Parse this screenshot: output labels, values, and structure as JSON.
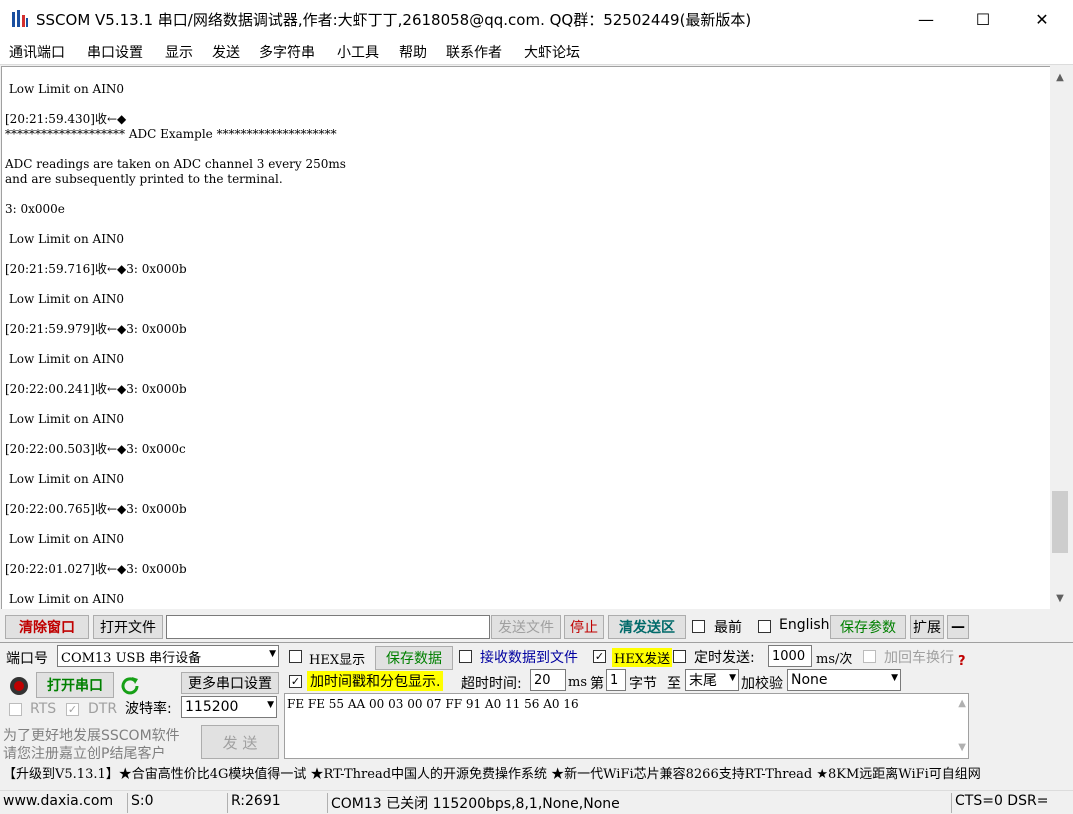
{
  "window": {
    "title": "SSCOM V5.13.1 串口/网络数据调试器,作者:大虾丁丁,2618058@qq.com. QQ群：52502449(最新版本)",
    "minimize": "—",
    "maximize": "☐",
    "close": "✕"
  },
  "menu": [
    "通讯端口",
    "串口设置",
    "显示",
    "发送",
    "多字符串",
    "小工具",
    "帮助",
    "联系作者",
    "大虾论坛"
  ],
  "terminal": {
    "lines": [
      " Low Limit on AIN0",
      "",
      "[20:21:59.430]收←◆",
      "******************** ADC Example ********************",
      "",
      "ADC readings are taken on ADC channel 3 every 250ms",
      "and are subsequently printed to the terminal.",
      "",
      "3: 0x000e",
      "",
      " Low Limit on AIN0",
      "",
      "[20:21:59.716]收←◆3: 0x000b",
      "",
      " Low Limit on AIN0",
      "",
      "[20:21:59.979]收←◆3: 0x000b",
      "",
      " Low Limit on AIN0",
      "",
      "[20:22:00.241]收←◆3: 0x000b",
      "",
      " Low Limit on AIN0",
      "",
      "[20:22:00.503]收←◆3: 0x000c",
      "",
      " Low Limit on AIN0",
      "",
      "[20:22:00.765]收←◆3: 0x000b",
      "",
      " Low Limit on AIN0",
      "",
      "[20:22:01.027]收←◆3: 0x000b",
      "",
      " Low Limit on AIN0"
    ]
  },
  "toolbar": {
    "clear_window": "清除窗口",
    "open_file": "打开文件",
    "file_path": "",
    "send_file": "发送文件",
    "stop": "停止",
    "clear_send": "清发送区",
    "topmost": "最前",
    "english": "English",
    "save_params": "保存参数",
    "expand": "扩展",
    "collapse": "—"
  },
  "port": {
    "label": "端口号",
    "value": "COM13 USB 串行设备",
    "open_button": "打开串口",
    "more_settings": "更多串口设置",
    "rts": "RTS",
    "dtr": "DTR",
    "baud_label": "波特率:",
    "baud_value": "115200"
  },
  "options": {
    "hex_display": "HEX显示",
    "save_data": "保存数据",
    "recv_to_file": "接收数据到文件",
    "hex_send": "HEX发送",
    "timed_send": "定时发送:",
    "interval": "1000",
    "interval_unit": "ms/次",
    "append_newline": "加回车换行",
    "timestamp": "加时间戳和分包显示.",
    "timeout_label": "超时时间:",
    "timeout_value": "20",
    "timeout_unit": "ms",
    "nth_label": "第",
    "nth_value": "1",
    "byte_label": "字节",
    "to_label": "至",
    "end_value": "末尾",
    "checksum_label": "加校验",
    "checksum_value": "None"
  },
  "send": {
    "data": "FE FE 55 AA 00 03 00 07 FF 91 A0 11 56 A0 16",
    "button": "发 送"
  },
  "promo": {
    "line1": "为了更好地发展SSCOM软件",
    "line2": "请您注册嘉立创P结尾客户"
  },
  "ticker": "【升级到V5.13.1】★合宙高性价比4G模块值得一试 ★RT-Thread中国人的开源免费操作系统 ★新一代WiFi芯片兼容8266支持RT-Thread ★8KM远距离WiFi可自组网",
  "status": {
    "website": "www.daxia.com",
    "sent": "S:0",
    "received": "R:2691",
    "port_state": "COM13 已关闭  115200bps,8,1,None,None",
    "lines": "CTS=0 DSR="
  }
}
